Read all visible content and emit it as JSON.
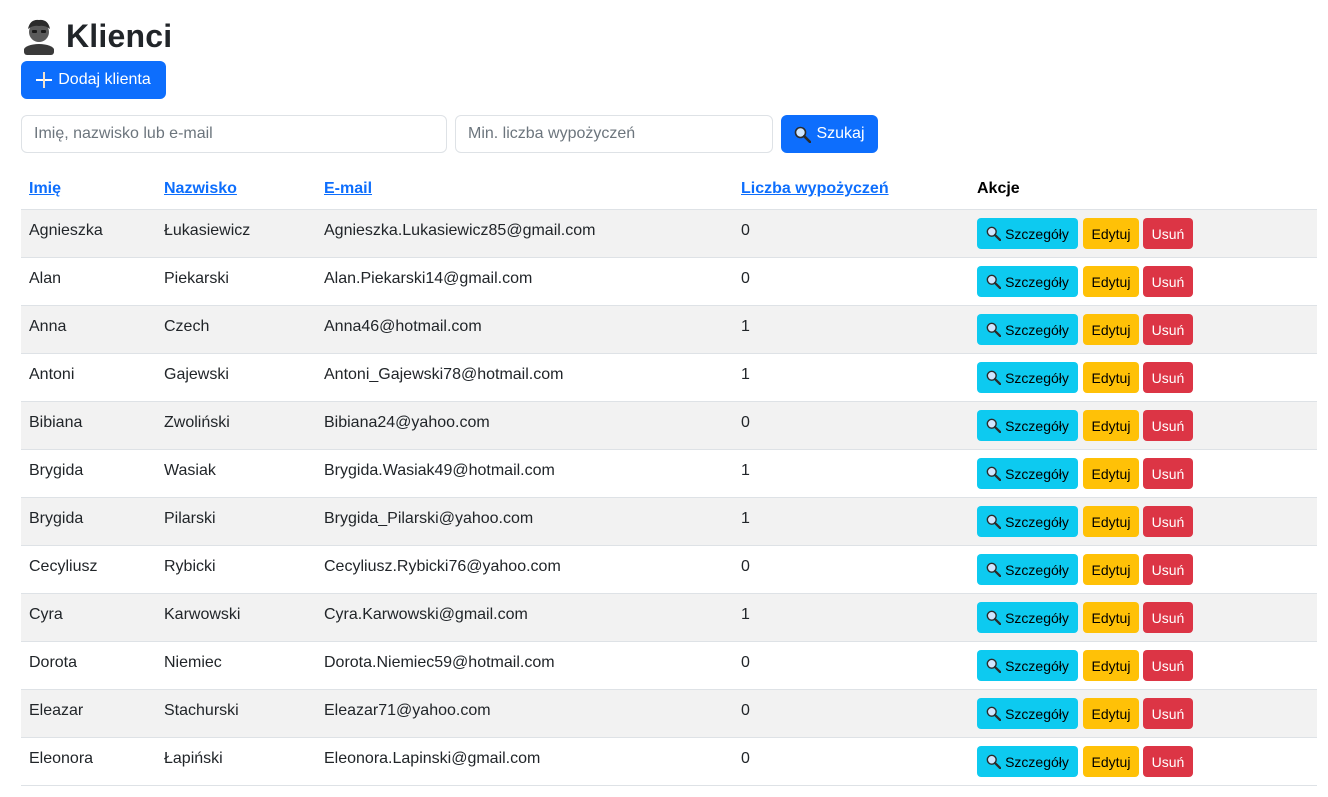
{
  "page": {
    "title": "Klienci",
    "title_icon": "person-icon",
    "add_button": "Dodaj klienta"
  },
  "search": {
    "name_placeholder": "Imię, nazwisko lub e-mail",
    "min_placeholder": "Min. liczba wypożyczeń",
    "button": "Szukaj"
  },
  "table": {
    "headers": [
      "Imię",
      "Nazwisko",
      "E-mail",
      "Liczba wypożyczeń",
      "Akcje"
    ],
    "actions": {
      "details": "Szczegóły",
      "edit": "Edytuj",
      "delete": "Usuń"
    },
    "rows": [
      [
        "Agnieszka",
        "Łukasiewicz",
        "Agnieszka.Lukasiewicz85@gmail.com",
        "0"
      ],
      [
        "Alan",
        "Piekarski",
        "Alan.Piekarski14@gmail.com",
        "0"
      ],
      [
        "Anna",
        "Czech",
        "Anna46@hotmail.com",
        "1"
      ],
      [
        "Antoni",
        "Gajewski",
        "Antoni_Gajewski78@hotmail.com",
        "1"
      ],
      [
        "Bibiana",
        "Zwoliński",
        "Bibiana24@yahoo.com",
        "0"
      ],
      [
        "Brygida",
        "Wasiak",
        "Brygida.Wasiak49@hotmail.com",
        "1"
      ],
      [
        "Brygida",
        "Pilarski",
        "Brygida_Pilarski@yahoo.com",
        "1"
      ],
      [
        "Cecyliusz",
        "Rybicki",
        "Cecyliusz.Rybicki76@yahoo.com",
        "0"
      ],
      [
        "Cyra",
        "Karwowski",
        "Cyra.Karwowski@gmail.com",
        "1"
      ],
      [
        "Dorota",
        "Niemiec",
        "Dorota.Niemiec59@hotmail.com",
        "0"
      ],
      [
        "Eleazar",
        "Stachurski",
        "Eleazar71@yahoo.com",
        "0"
      ],
      [
        "Eleonora",
        "Łapiński",
        "Eleonora.Lapinski@gmail.com",
        "0"
      ]
    ]
  },
  "colors": {
    "primary": "#0d6efd",
    "info": "#0dcaf0",
    "warning": "#ffc107",
    "danger": "#dc3545",
    "stripe": "#f2f2f2"
  }
}
